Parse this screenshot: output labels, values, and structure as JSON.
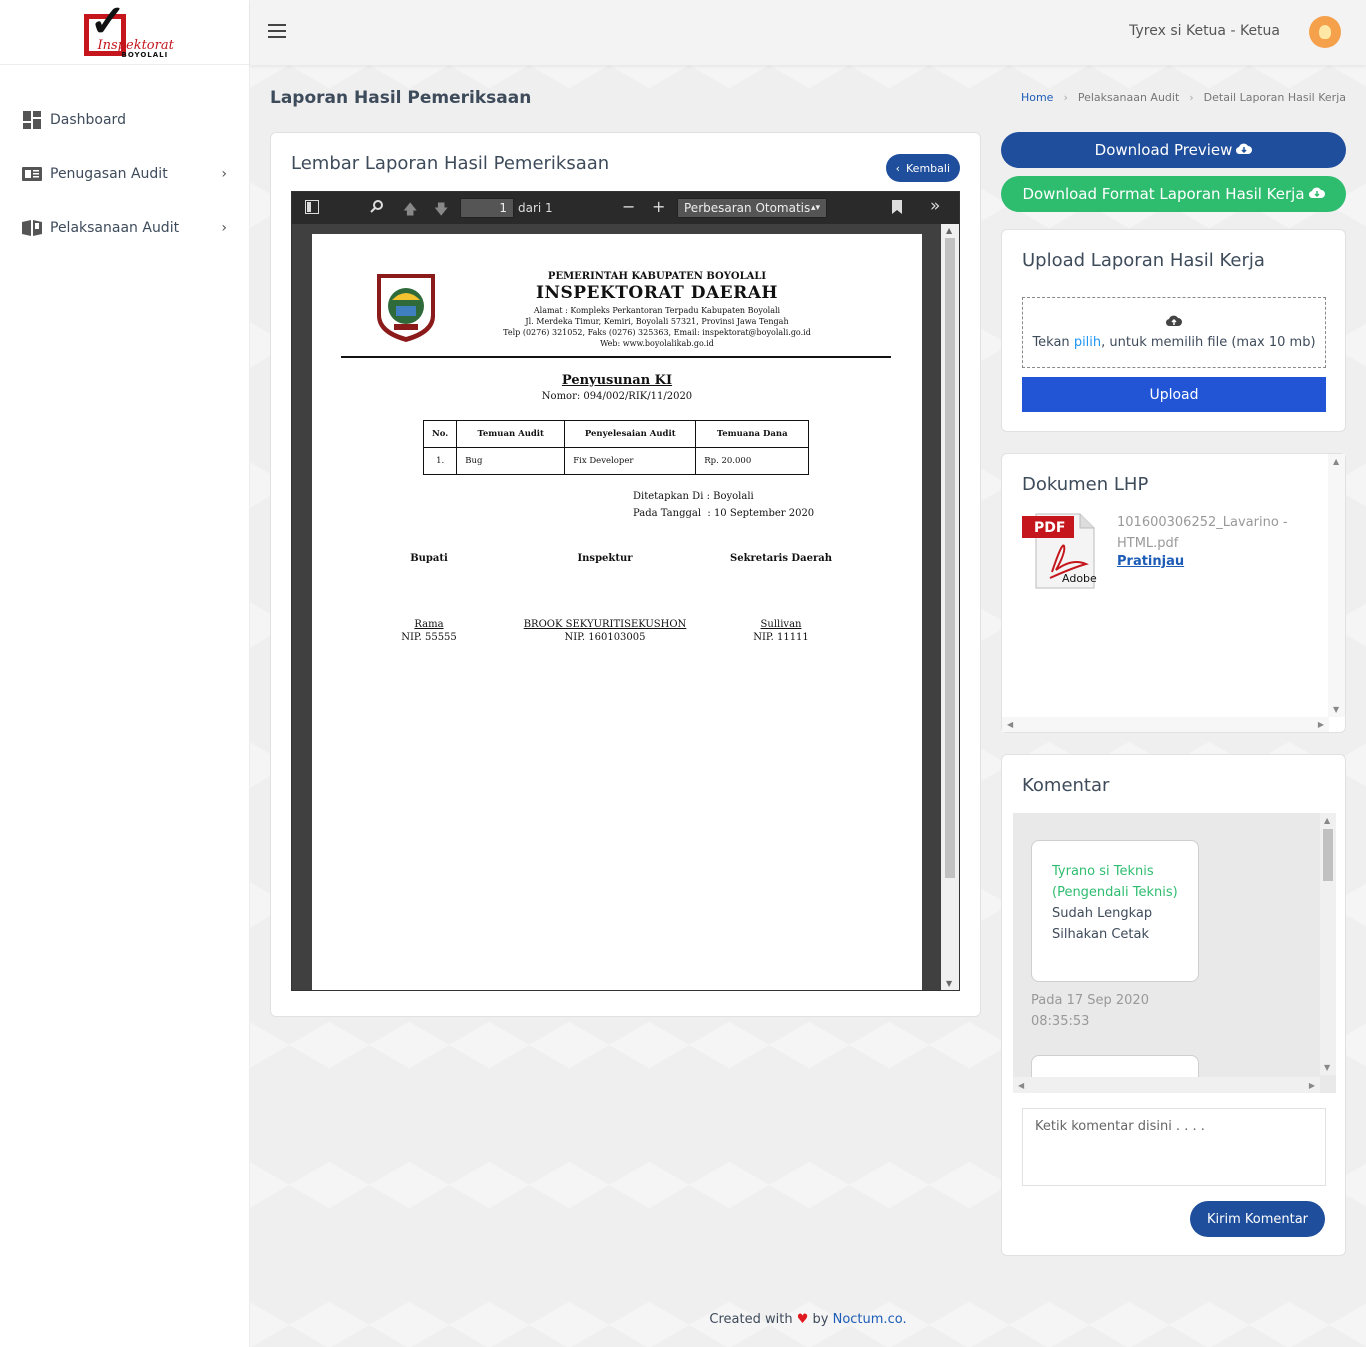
{
  "brand": {
    "logo_text": "Inspektorat",
    "logo_sub": "BOYOLALI"
  },
  "sidebar": {
    "items": [
      {
        "label": "Dashboard",
        "icon": "dashboard-icon"
      },
      {
        "label": "Penugasan Audit",
        "icon": "newspaper-icon"
      },
      {
        "label": "Pelaksanaan Audit",
        "icon": "book-icon"
      }
    ]
  },
  "header": {
    "user": "Tyrex si Ketua - Ketua"
  },
  "page": {
    "title": "Laporan Hasil Pemeriksaan",
    "breadcrumb": [
      "Home",
      "Pelaksanaan Audit",
      "Detail Laporan Hasil Kerja"
    ]
  },
  "main_card": {
    "title": "Lembar Laporan Hasil Pemeriksaan",
    "back_label": "Kembali"
  },
  "viewer": {
    "page_number": "1",
    "page_count": "dari 1",
    "zoom": "Perbesaran Otomatis"
  },
  "document": {
    "gov": "PEMERINTAH KABUPATEN BOYOLALI",
    "office": "INSPEKTORAT DAERAH",
    "address_lines": [
      "Alamat : Kompleks Perkantoran Terpadu Kabupaten Boyolali",
      "Jl. Merdeka Timur, Kemiri, Boyolali 57321, Provinsi Jawa Tengah",
      "Telp (0276) 321052, Faks (0276) 325363, Email: inspektorat@boyolali.go.id",
      "Web: www.boyolalikab.go.id"
    ],
    "title": "Penyusunan KI",
    "nomor": "Nomor: 094/002/RIK/11/2020",
    "table": {
      "headers": [
        "No.",
        "Temuan Audit",
        "Penyelesaian Audit",
        "Temuana Dana"
      ],
      "rows": [
        [
          "1.",
          "Bug",
          "Fix Developer",
          "Rp. 20.000"
        ]
      ]
    },
    "place_label": "Ditetapkan Di : Boyolali",
    "date_label": "Pada Tanggal  : 10 September 2020",
    "signatories": [
      {
        "role": "Bupati",
        "name": "Rama",
        "nip": "NIP. 55555"
      },
      {
        "role": "Inspektur",
        "name": "BROOK SEKYURITISEKUSHON",
        "nip": "NIP. 160103005"
      },
      {
        "role": "Sekretaris Daerah",
        "name": "Sullivan",
        "nip": "NIP. 11111"
      }
    ]
  },
  "actions": {
    "download_preview": "Download Preview",
    "download_format": "Download Format Laporan Hasil Kerja"
  },
  "upload": {
    "title": "Upload Laporan Hasil Kerja",
    "hint_prefix": "Tekan ",
    "hint_link": "pilih",
    "hint_suffix": ", untuk memilih file (max 10 mb)",
    "button": "Upload"
  },
  "dokumen": {
    "title": "Dokumen LHP",
    "file_name": "101600306252_Lavarino - HTML.pdf",
    "preview_label": "Pratinjau",
    "icon_text": "PDF",
    "icon_brand": "Adobe"
  },
  "komentar": {
    "title": "Komentar",
    "comments": [
      {
        "author": "Tyrano si Teknis (Pengendali Teknis)",
        "text": "Sudah Lengkap Silhakan Cetak",
        "time": "Pada 17 Sep 2020 08:35:53"
      }
    ],
    "placeholder": "Ketik komentar disini . . . .",
    "send": "Kirim Komentar"
  },
  "footer": {
    "prefix": "Created with",
    "by": "by",
    "brand": "Noctum.co",
    "suffix": "."
  },
  "colors": {
    "primary": "#1e4e9c",
    "success": "#2ebd6f",
    "upload": "#2255d6",
    "link": "#1c5cb7"
  }
}
